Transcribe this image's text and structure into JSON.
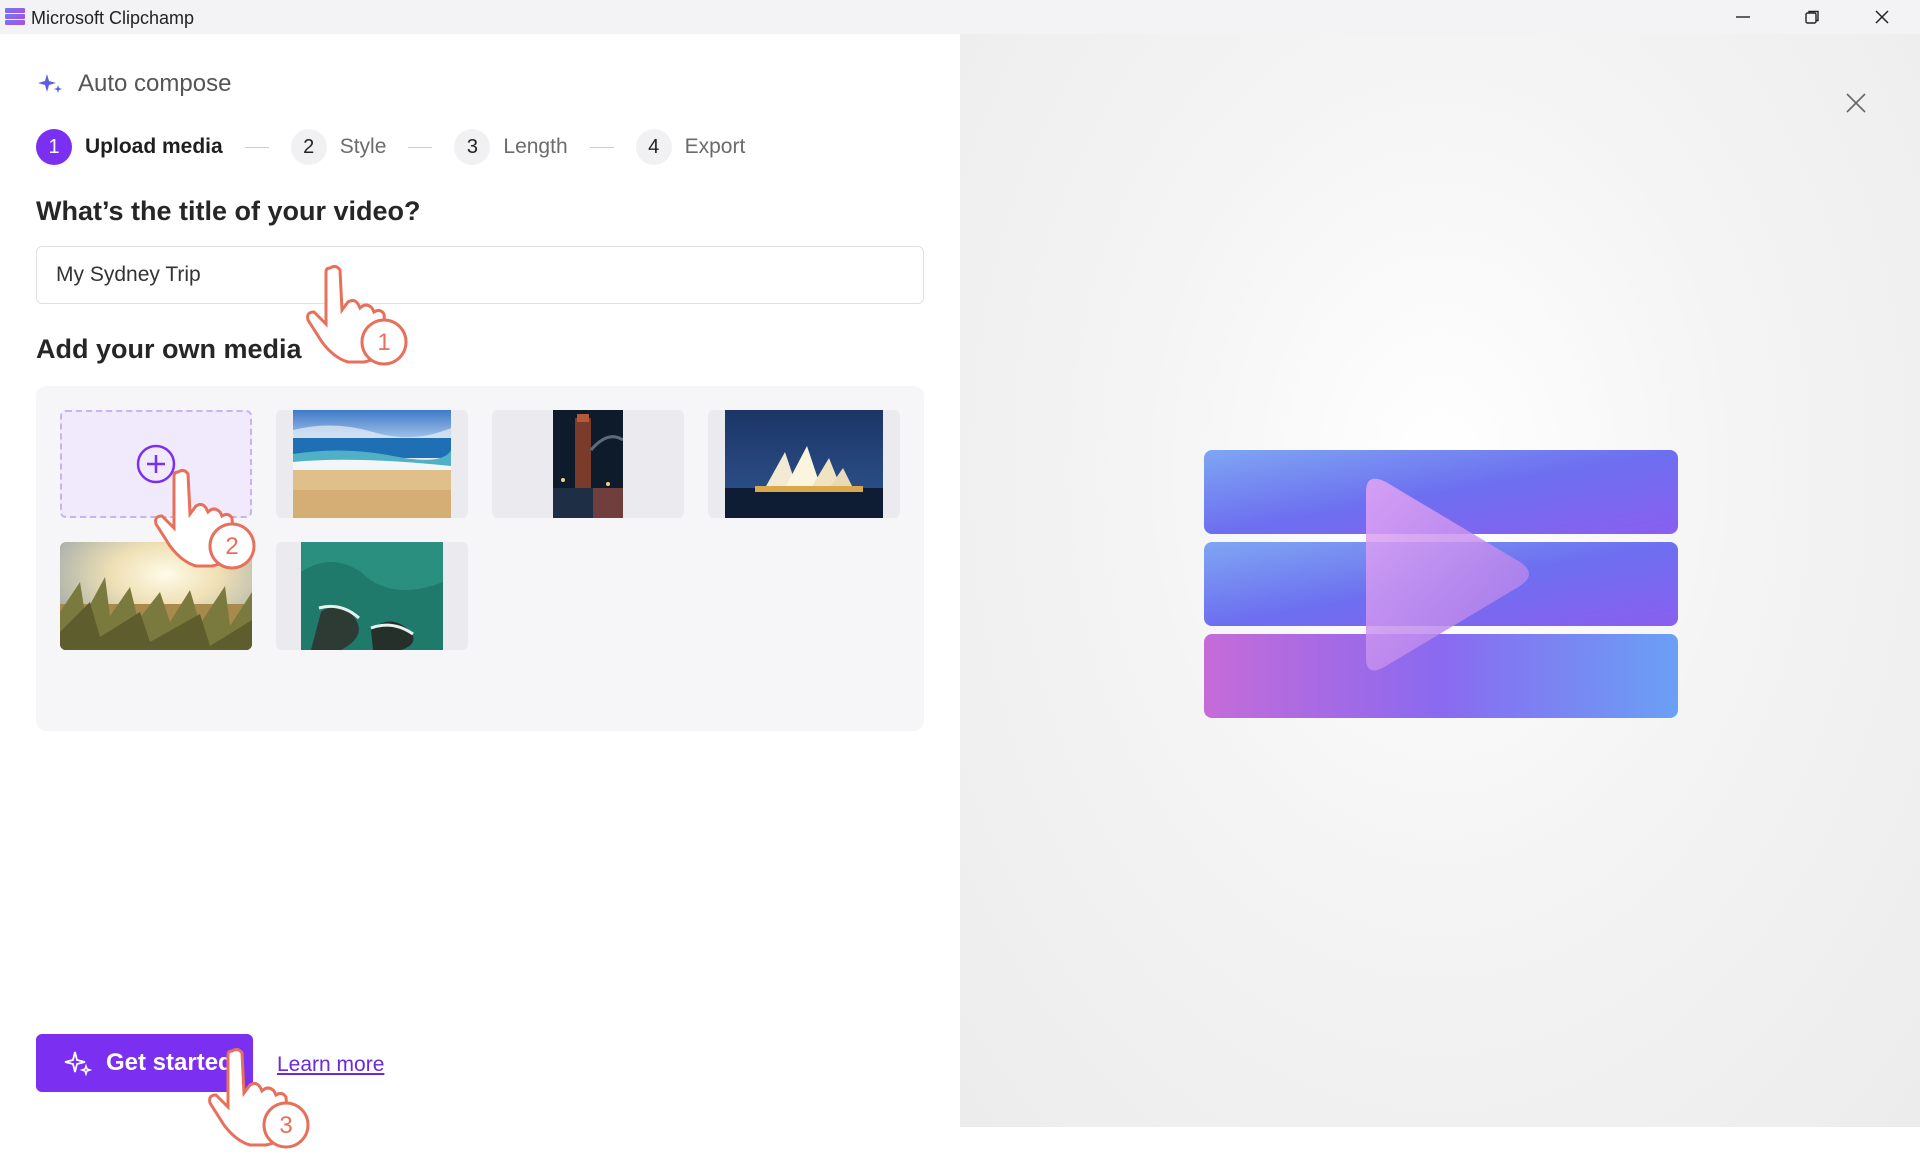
{
  "window": {
    "title": "Microsoft Clipchamp",
    "minimize_icon": "minimize-icon",
    "restore_icon": "restore-icon",
    "close_icon": "close-icon"
  },
  "panel": {
    "title": "Auto compose",
    "icon": "sparkle-icon"
  },
  "steps": [
    {
      "num": "1",
      "label": "Upload media",
      "active": true
    },
    {
      "num": "2",
      "label": "Style",
      "active": false
    },
    {
      "num": "3",
      "label": "Length",
      "active": false
    },
    {
      "num": "4",
      "label": "Export",
      "active": false
    }
  ],
  "form": {
    "title_question": "What’s the title of your video?",
    "title_value": "My Sydney Trip",
    "media_heading": "Add your own media"
  },
  "media": {
    "add_icon": "plus-circle-icon",
    "items": [
      {
        "name": "beach"
      },
      {
        "name": "harbour-bridge-night"
      },
      {
        "name": "opera-house"
      },
      {
        "name": "sunset-grass"
      },
      {
        "name": "coastal-rocks-aerial"
      }
    ]
  },
  "actions": {
    "get_started": "Get started",
    "learn_more": "Learn more"
  },
  "annotations": {
    "step1": "1",
    "step2": "2",
    "step3": "3"
  },
  "colors": {
    "accent": "#7b2ff0",
    "link": "#6a2ad8",
    "annotation": "#e8705a"
  }
}
